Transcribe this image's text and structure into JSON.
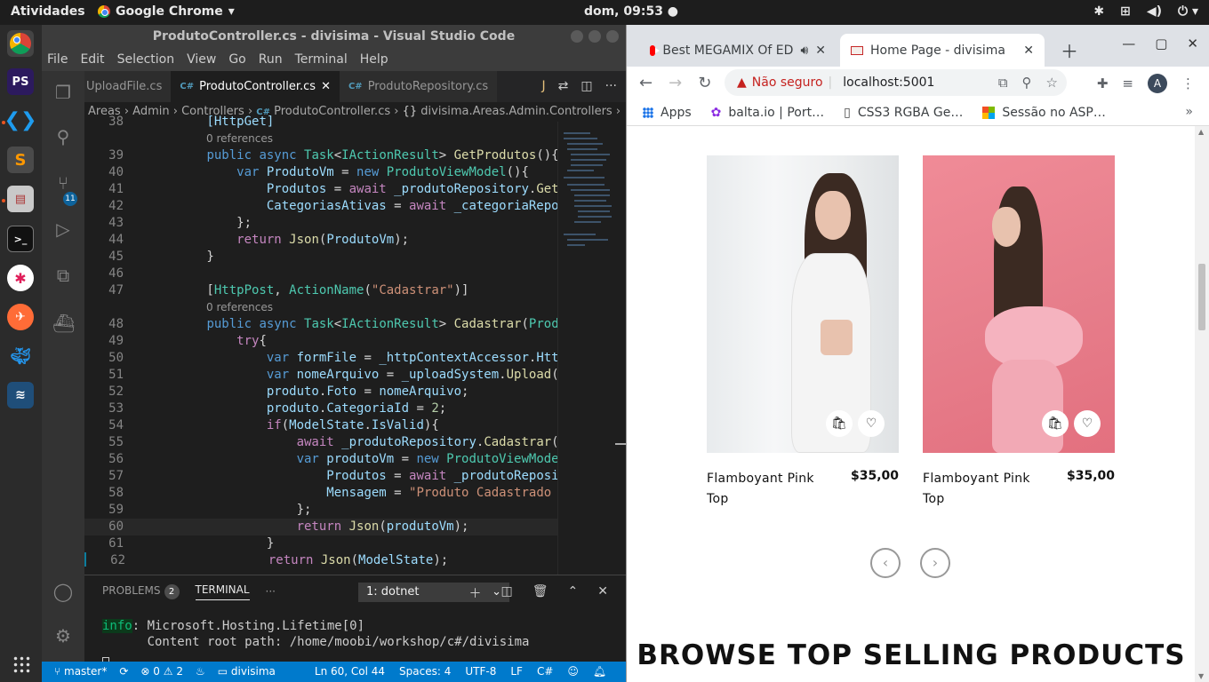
{
  "topbar": {
    "activities": "Atividades",
    "app_name": "Google Chrome",
    "clock": "dom, 09:53"
  },
  "vscode": {
    "title": "ProdutoController.cs - divisima - Visual Studio Code",
    "menu": [
      "File",
      "Edit",
      "Selection",
      "View",
      "Go",
      "Run",
      "Terminal",
      "Help"
    ],
    "tabs": [
      {
        "label": "UploadFile.cs",
        "active": false
      },
      {
        "label": "ProdutoController.cs",
        "active": true
      },
      {
        "label": "ProdutoRepository.cs",
        "active": false
      }
    ],
    "scm_badge": "11",
    "breadcrumb": [
      "Areas",
      "Admin",
      "Controllers",
      "ProdutoController.cs",
      "divisima.Areas.Admin.Controllers"
    ],
    "code_lines": [
      {
        "n": "38",
        "html": "<span class=\"v\">[HttpGet]</span>"
      },
      {
        "lens": "0 references"
      },
      {
        "n": "39",
        "html": "<span class=\"k\">public async </span><span class=\"t\">Task</span>&lt;<span class=\"t\">IActionResult</span>&gt; <span class=\"f\">GetProdutos</span>(){"
      },
      {
        "n": "40",
        "html": "    <span class=\"k\">var </span><span class=\"v\">ProdutoVm</span> = <span class=\"k\">new </span><span class=\"t\">ProdutoViewModel</span>(){"
      },
      {
        "n": "41",
        "html": "        <span class=\"v\">Produtos</span> = <span class=\"ctl\">await </span><span class=\"v\">_produtoRepository</span>.<span class=\"f\">Get</span>"
      },
      {
        "n": "42",
        "html": "        <span class=\"v\">CategoriasAtivas</span> = <span class=\"ctl\">await </span><span class=\"v\">_categoriaRepo</span>"
      },
      {
        "n": "43",
        "html": "    };"
      },
      {
        "n": "44",
        "html": "    <span class=\"ctl\">return </span><span class=\"f\">Json</span>(<span class=\"v\">ProdutoVm</span>);"
      },
      {
        "n": "45",
        "html": "}"
      },
      {
        "n": "46",
        "html": ""
      },
      {
        "n": "47",
        "html": "[<span class=\"t\">HttpPost</span>, <span class=\"t\">ActionName</span>(<span class=\"s\">\"Cadastrar\"</span>)]"
      },
      {
        "lens": "0 references"
      },
      {
        "n": "48",
        "html": "<span class=\"k\">public async </span><span class=\"t\">Task</span>&lt;<span class=\"t\">IActionResult</span>&gt; <span class=\"f\">Cadastrar</span>(<span class=\"t\">Prod</span>"
      },
      {
        "n": "49",
        "html": "    <span class=\"ctl\">try</span>{"
      },
      {
        "n": "50",
        "html": "        <span class=\"k\">var </span><span class=\"v\">formFile</span> = <span class=\"v\">_httpContextAccessor</span>.<span class=\"v\">Htt</span>"
      },
      {
        "n": "51",
        "html": "        <span class=\"k\">var </span><span class=\"v\">nomeArquivo</span> = <span class=\"v\">_uploadSystem</span>.<span class=\"f\">Upload</span>("
      },
      {
        "n": "52",
        "html": "        <span class=\"v\">produto</span>.<span class=\"v\">Foto</span> = <span class=\"v\">nomeArquivo</span>;"
      },
      {
        "n": "53",
        "html": "        <span class=\"v\">produto</span>.<span class=\"v\">CategoriaId</span> = <span class=\"n\">2</span>;"
      },
      {
        "n": "54",
        "html": "        <span class=\"ctl\">if</span>(<span class=\"v\">ModelState</span>.<span class=\"v\">IsValid</span>){"
      },
      {
        "n": "55",
        "html": "            <span class=\"ctl\">await </span><span class=\"v\">_produtoRepository</span>.<span class=\"f\">Cadastrar</span>("
      },
      {
        "n": "56",
        "html": "            <span class=\"k\">var </span><span class=\"v\">produtoVm</span> = <span class=\"k\">new </span><span class=\"t\">ProdutoViewMode</span>"
      },
      {
        "n": "57",
        "html": "                <span class=\"v\">Produtos</span> = <span class=\"ctl\">await </span><span class=\"v\">_produtoReposi</span>"
      },
      {
        "n": "58",
        "html": "                <span class=\"v\">Mensagem</span> = <span class=\"s\">\"Produto Cadastrado </span>"
      },
      {
        "n": "59",
        "html": "            };"
      },
      {
        "n": "60",
        "html": "            <span class=\"ctl\">return </span><span class=\"f\">Json</span>(<span class=\"v\">produtoVm</span>);"
      },
      {
        "n": "61",
        "html": "        }"
      },
      {
        "n": "62",
        "html": "        <span class=\"ctl\">return </span><span class=\"f\">Json</span>(<span class=\"v\">ModelState</span>);"
      }
    ],
    "panel": {
      "problems_label": "PROBLEMS",
      "problems_count": "2",
      "terminal_label": "TERMINAL",
      "more": "···",
      "terminal_select": "1: dotnet",
      "terminal_lines": [
        "info: Microsoft.Hosting.Lifetime[0]",
        "      Content root path: /home/moobi/workshop/c#/divisima"
      ]
    },
    "status": {
      "branch": "master*",
      "errors": "0",
      "warnings": "2",
      "folder": "divisima",
      "position": "Ln 60, Col 44",
      "spaces": "Spaces: 4",
      "encoding": "UTF-8",
      "eol": "LF",
      "language": "C#"
    }
  },
  "chrome": {
    "tabs": [
      {
        "label": "Best MEGAMIX Of ED",
        "active": false
      },
      {
        "label": "Home Page - divisima",
        "active": true
      }
    ],
    "omnibox": {
      "security": "Não seguro",
      "url": "localhost:5001"
    },
    "avatar": "A",
    "bookmarks": [
      "Apps",
      "balta.io | Port…",
      "CSS3 RGBA Ge…",
      "Sessão no ASP…"
    ],
    "products": [
      {
        "name": "Flamboyant Pink Top",
        "price": "$35,00"
      },
      {
        "name": "Flamboyant Pink Top",
        "price": "$35,00"
      }
    ],
    "section_title": "BROWSE TOP SELLING PRODUCTS"
  }
}
